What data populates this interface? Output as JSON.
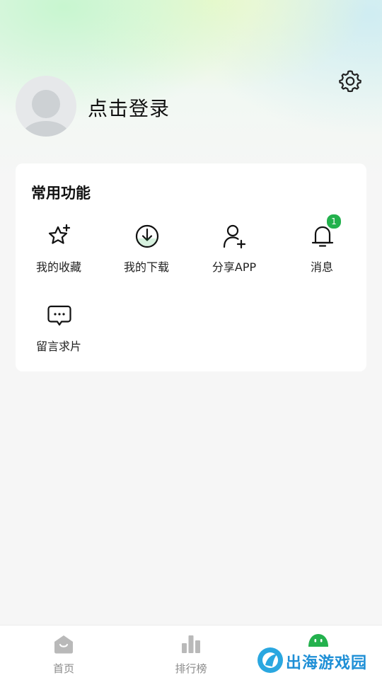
{
  "header": {
    "login_text": "点击登录",
    "avatar_icon": "default-avatar-icon",
    "settings_icon": "gear-icon"
  },
  "common_functions": {
    "title": "常用功能",
    "items": [
      {
        "label": "我的收藏",
        "icon": "star-sparkle-icon"
      },
      {
        "label": "我的下载",
        "icon": "download-circle-icon"
      },
      {
        "label": "分享APP",
        "icon": "add-user-icon"
      },
      {
        "label": "消息",
        "icon": "bell-icon",
        "badge": "1"
      },
      {
        "label": "留言求片",
        "icon": "chat-bubble-icon"
      }
    ]
  },
  "bottom_nav": {
    "items": [
      {
        "label": "首页",
        "icon": "home-icon"
      },
      {
        "label": "排行榜",
        "icon": "bar-chart-icon"
      },
      {
        "label": "",
        "icon": "mascot-icon",
        "active": true
      }
    ]
  },
  "watermark": {
    "text": "出海游戏园"
  },
  "colors": {
    "accent_green": "#23b14d",
    "watermark_blue": "#1e8fd6",
    "nav_inactive": "#8a8a8a"
  }
}
